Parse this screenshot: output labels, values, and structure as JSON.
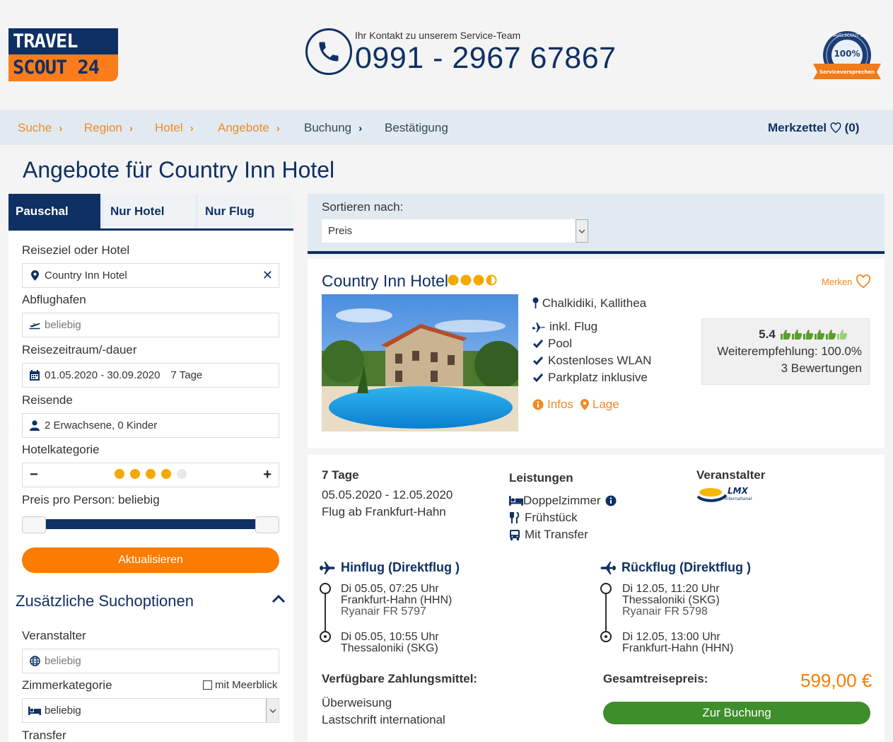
{
  "logo": {
    "line1": "TRAVEL",
    "line2": "SCOUT 24"
  },
  "contact": {
    "label": "Ihr Kontakt zu unserem Service-Team",
    "phone": "0991 - 2967 67867"
  },
  "seal": {
    "arc_text": "TRAVELSCOUT 24",
    "percent": "100%",
    "ribbon": "Serviceversprechen"
  },
  "breadcrumb": [
    {
      "label": "Suche",
      "state": "active"
    },
    {
      "label": "Region",
      "state": "active"
    },
    {
      "label": "Hotel",
      "state": "active"
    },
    {
      "label": "Angebote",
      "state": "active"
    },
    {
      "label": "Buchung",
      "state": "inactive"
    },
    {
      "label": "Bestätigung",
      "state": "inactive"
    }
  ],
  "merkzettel": {
    "label": "Merkzettel",
    "count": "(0)"
  },
  "page_title": "Angebote für Country Inn Hotel",
  "tabs": [
    "Pauschal",
    "Nur Hotel",
    "Nur Flug"
  ],
  "search": {
    "destination_label": "Reiseziel oder Hotel",
    "destination_value": "Country Inn Hotel",
    "airport_label": "Abflughafen",
    "airport_placeholder": "beliebig",
    "period_label": "Reisezeitraum/-dauer",
    "period_value": "01.05.2020 - 30.09.2020",
    "duration_value": "7 Tage",
    "travellers_label": "Reisende",
    "travellers_value": "2 Erwachsene, 0 Kinder",
    "category_label": "Hotelkategorie",
    "category_level": 4,
    "category_max": 5,
    "price_label": "Preis pro Person: beliebig",
    "update_button": "Aktualisieren"
  },
  "extra": {
    "title": "Zusätzliche Suchoptionen",
    "operator_label": "Veranstalter",
    "operator_placeholder": "beliebig",
    "room_label": "Zimmerkategorie",
    "seaview_label": "mit Meerblick",
    "room_value": "beliebig",
    "transfer_label": "Transfer"
  },
  "sort": {
    "label": "Sortieren nach:",
    "value": "Preis"
  },
  "hotel": {
    "name": "Country Inn Hotel",
    "stars": 3.5,
    "merken_label": "Merken",
    "location": "Chalkidiki, Kallithea",
    "features": [
      "inkl. Flug",
      "Pool",
      "Kostenloses WLAN",
      "Parkplatz inklusive"
    ],
    "infos_label": "Infos",
    "lage_label": "Lage",
    "rating_score": "5.4",
    "rating_level": 5.4,
    "rating_max": 6,
    "recommendation": "Weiterempfehlung: 100.0%",
    "reviews": "3 Bewertungen"
  },
  "offer": {
    "duration": "7 Tage",
    "dates": "05.05.2020 - 12.05.2020",
    "flight_from": "Flug ab Frankfurt-Hahn",
    "services_title": "Leistungen",
    "services": [
      "Doppelzimmer",
      "Frühstück",
      "Mit Transfer"
    ],
    "operator_title": "Veranstalter",
    "operator_logo_text": "LMX",
    "operator_logo_sub": "International",
    "outbound": {
      "title": "Hinflug (Direktflug )",
      "dep_time": "Di 05.05, 07:25 Uhr",
      "dep_airport": "Frankfurt-Hahn (HHN)",
      "carrier": "Ryanair FR 5797",
      "arr_time": "Di 05.05, 10:55 Uhr",
      "arr_airport": "Thessaloniki (SKG)"
    },
    "return": {
      "title": "Rückflug (Direktflug )",
      "dep_time": "Di 12.05, 11:20 Uhr",
      "dep_airport": "Thessaloniki (SKG)",
      "carrier": "Ryanair FR 5798",
      "arr_time": "Di 12.05, 13:00 Uhr",
      "arr_airport": "Frankfurt-Hahn (HHN)"
    },
    "payment_title": "Verfügbare Zahlungsmittel:",
    "payments": [
      "Überweisung",
      "Lastschrift international"
    ],
    "total_label": "Gesamtreisepreis:",
    "price": "599,00 €",
    "book_button": "Zur Buchung"
  },
  "colors": {
    "navy": "#0f3063",
    "orange": "#fa7c00",
    "green": "#3f8e2c",
    "star": "#f5a800"
  }
}
